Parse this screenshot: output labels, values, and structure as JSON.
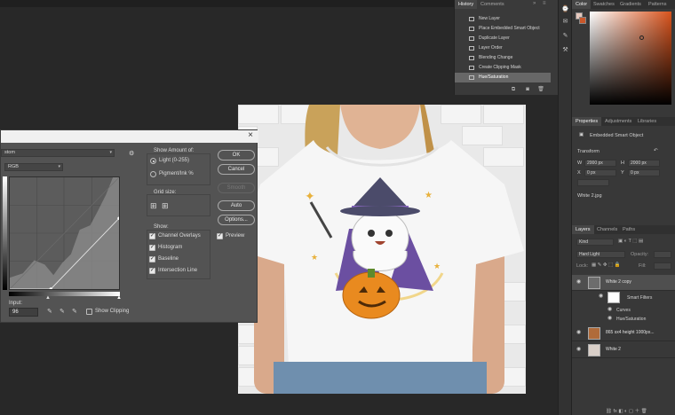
{
  "history_panel": {
    "tabs": [
      "History",
      "Comments"
    ],
    "items": [
      {
        "label": "New Layer"
      },
      {
        "label": "Place Embedded Smart Object"
      },
      {
        "label": "Duplicate Layer"
      },
      {
        "label": "Layer Order"
      },
      {
        "label": "Blending Change"
      },
      {
        "label": "Create Clipping Mask"
      },
      {
        "label": "Hue/Saturation"
      }
    ],
    "selected_index": 6
  },
  "curves_dialog": {
    "preset_value": "stom",
    "channel": "RGB",
    "input_label": "Input:",
    "input_value": "96",
    "show_clipping_label": "Show Clipping",
    "show_amount_label": "Show Amount of:",
    "light_label": "Light  (0-255)",
    "pigment_label": "Pigment/Ink %",
    "grid_size_label": "Grid size:",
    "show_label": "Show:",
    "show_options": [
      {
        "label": "Channel Overlays"
      },
      {
        "label": "Histogram"
      },
      {
        "label": "Baseline"
      },
      {
        "label": "Intersection Line"
      }
    ],
    "buttons": {
      "ok": "OK",
      "cancel": "Cancel",
      "smooth": "Smooth",
      "auto": "Auto",
      "options": "Options..."
    },
    "preview_label": "Preview"
  },
  "color_panel": {
    "tabs": [
      "Color",
      "Swatches",
      "Gradients",
      "Patterns"
    ],
    "hue": "#d9531c"
  },
  "properties_panel": {
    "tabs": [
      "Properties",
      "Adjustments",
      "Libraries"
    ],
    "object_type": "Embedded Smart Object",
    "transform_label": "Transform",
    "w_label": "W",
    "w_value": "2000 px",
    "h_label": "H",
    "h_value": "2000 px",
    "x_label": "X",
    "x_value": "0 px",
    "y_label": "Y",
    "y_value": "0 px",
    "file_name": "White 2.jpg"
  },
  "layers_panel": {
    "tabs": [
      "Layers",
      "Channels",
      "Paths"
    ],
    "kind_label": "Kind",
    "blend_mode": "Hard Light",
    "opacity_label": "Opacity:",
    "lock_label": "Lock:",
    "fill_label": "Fill:",
    "layers": [
      {
        "name": "White 2 copy"
      },
      {
        "name": "Smart Filters"
      },
      {
        "name": "Curves"
      },
      {
        "name": "Hue/Saturation"
      },
      {
        "name": "865 sx4 height 1000px..."
      },
      {
        "name": "White 2"
      }
    ]
  }
}
